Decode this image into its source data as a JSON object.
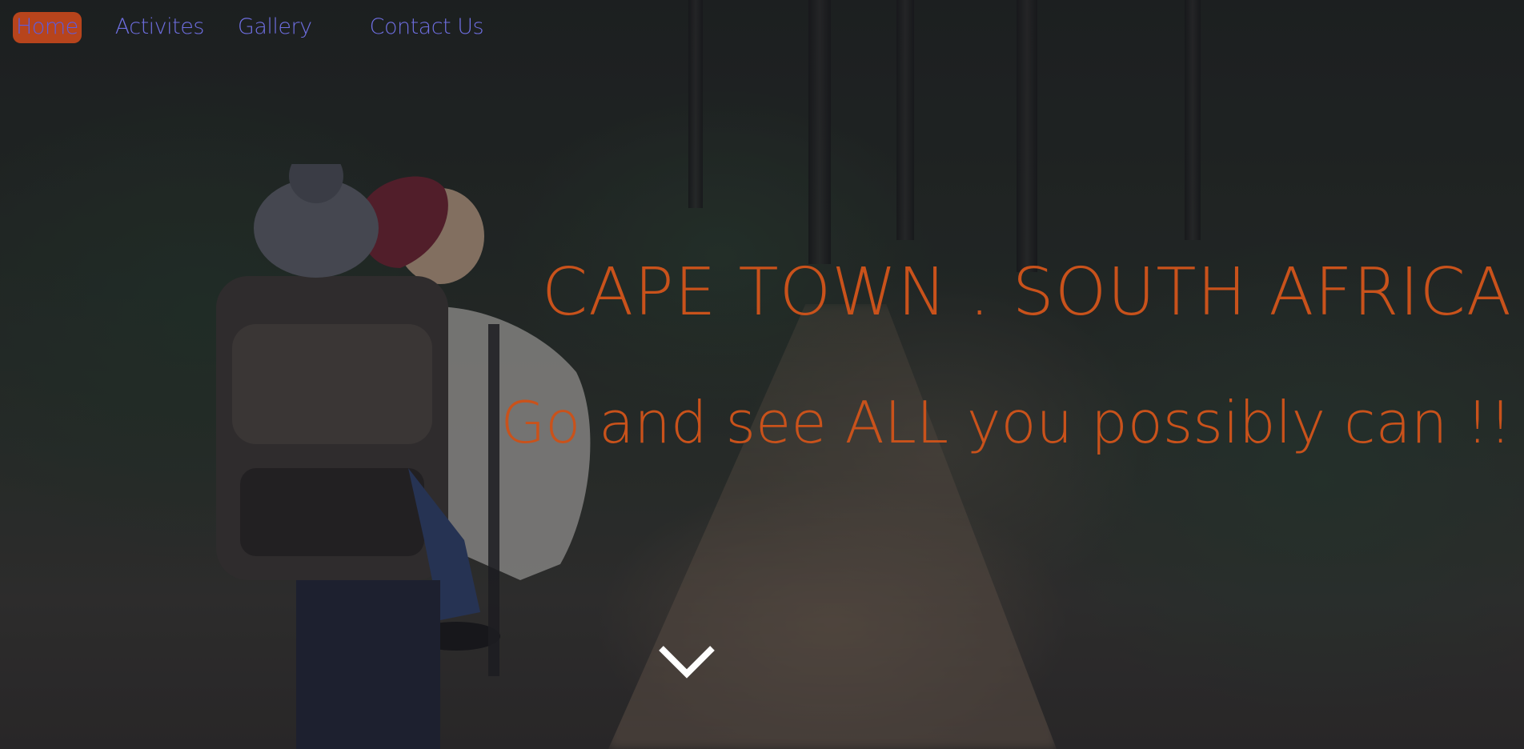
{
  "nav": {
    "items": [
      {
        "label": "Home",
        "active": true
      },
      {
        "label": "Activites",
        "active": false
      },
      {
        "label": "Gallery",
        "active": false
      },
      {
        "label": "Contact Us",
        "active": false
      }
    ]
  },
  "hero": {
    "title": "CAPE TOWN . SOUTH AFRICA",
    "tagline": "Go and see ALL you possibly can !!"
  },
  "icons": {
    "scroll": "chevron-down-icon"
  },
  "colors": {
    "accent": "#c9521b",
    "nav_text": "#6e6ee0",
    "active_bg": "#b7441c",
    "chevron": "#ffffff"
  }
}
